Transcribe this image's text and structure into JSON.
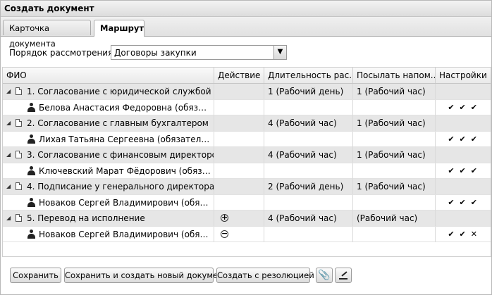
{
  "window": {
    "title": "Создать документ"
  },
  "tabs": [
    {
      "label": "Карточка документа",
      "active": false
    },
    {
      "label": "Маршрут",
      "active": true
    }
  ],
  "route": {
    "label": "Порядок рассмотрения:",
    "value": "Договоры закупки"
  },
  "grid": {
    "columns": {
      "fio": "ФИО",
      "action": "Действие",
      "duration": "Длительность рас...",
      "reminder": "Посылать напом...",
      "settings": "Настройки"
    },
    "rows": [
      {
        "type": "step",
        "title": "1. Согласование с юридической службой",
        "duration": "1 (Рабочий день)",
        "reminder": "1 (Рабочий час)"
      },
      {
        "type": "person",
        "name": "Белова Анастасия Федоровна (обязате...",
        "checks": "✔✔✔"
      },
      {
        "type": "step",
        "title": "2. Согласование с главным бухгалтером",
        "duration": "4 (Рабочий час)",
        "reminder": "1 (Рабочий час)"
      },
      {
        "type": "person",
        "name": "Лихая Татьяна Сергеевна (обязательно ...",
        "checks": "✔✔✔"
      },
      {
        "type": "step",
        "title": "3. Согласование с финансовым директором",
        "duration": "4 (Рабочий час)",
        "reminder": "1 (Рабочий час)"
      },
      {
        "type": "person",
        "name": "Ключевский Марат Фёдорович (обязате...",
        "checks": "✔✔✔"
      },
      {
        "type": "step",
        "title": "4. Подписание у генерального директора",
        "duration": "2 (Рабочий день)",
        "reminder": "1 (Рабочий час)"
      },
      {
        "type": "person",
        "name": "Новаков Сергей Владимирович (обязате...",
        "checks": "✔✔✔"
      },
      {
        "type": "step",
        "title": "5. Перевод на исполнение",
        "duration": "4 (Рабочий час)",
        "reminder": "(Рабочий час)",
        "action_icon": "plus-circle-icon",
        "action_symbol": "+"
      },
      {
        "type": "person",
        "name": "Новаков Сергей Владимирович (обязате...",
        "checks": "✔✔✕",
        "action_icon": "minus-circle-icon",
        "action_symbol": "−"
      }
    ]
  },
  "buttons": {
    "save": "Сохранить",
    "save_new": "Сохранить и создать новый документ",
    "create_resolution": "Создать с резолюцией",
    "attach_icon": "paperclip-icon",
    "sign_icon": "signature-icon"
  }
}
